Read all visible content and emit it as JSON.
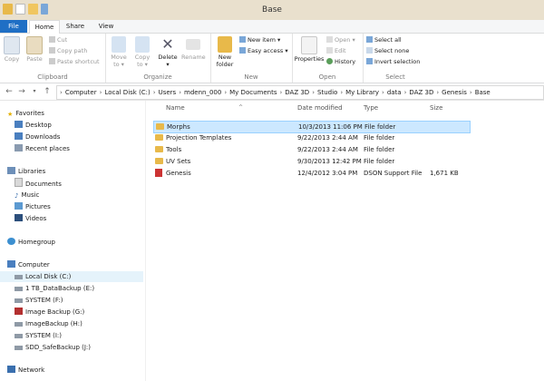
{
  "window": {
    "title": "Base"
  },
  "colors": {
    "file_tab": "#1f6fc5",
    "titlebar": "#e9e0cd",
    "folder": "#e8b94a",
    "selection": "#cce8ff"
  },
  "tabs": [
    "File",
    "Home",
    "Share",
    "View"
  ],
  "ribbon": {
    "clipboard": {
      "label": "Clipboard",
      "copy": "Copy",
      "paste": "Paste",
      "cut": "Cut",
      "copy_path": "Copy path",
      "paste_shortcut": "Paste shortcut"
    },
    "organize": {
      "label": "Organize",
      "move_to": "Move to",
      "copy_to": "Copy to",
      "delete": "Delete",
      "rename": "Rename"
    },
    "new": {
      "label": "New",
      "new_folder": "New folder",
      "new_item": "New item",
      "easy_access": "Easy access"
    },
    "open": {
      "label": "Open",
      "properties": "Properties",
      "open": "Open",
      "edit": "Edit",
      "history": "History"
    },
    "select": {
      "label": "Select",
      "select_all": "Select all",
      "select_none": "Select none",
      "invert": "Invert selection"
    }
  },
  "breadcrumb": [
    "Computer",
    "Local Disk (C:)",
    "Users",
    "mdenn_000",
    "My Documents",
    "DAZ 3D",
    "Studio",
    "My Library",
    "data",
    "DAZ 3D",
    "Genesis",
    "Base"
  ],
  "nav": {
    "favorites": "Favorites",
    "favorites_items": [
      "Desktop",
      "Downloads",
      "Recent places"
    ],
    "libraries": "Libraries",
    "libraries_items": [
      "Documents",
      "Music",
      "Pictures",
      "Videos"
    ],
    "homegroup": "Homegroup",
    "computer": "Computer",
    "computer_items": [
      "Local Disk (C:)",
      "1 TB_DataBackup (E:)",
      "SYSTEM (F:)",
      "Image Backup (G:)",
      "ImageBackup (H:)",
      "SYSTEM (I:)",
      "SDD_SafeBackup (J:)"
    ],
    "network": "Network"
  },
  "columns": {
    "name": "Name",
    "date": "Date modified",
    "type": "Type",
    "size": "Size"
  },
  "files": [
    {
      "name": "Morphs",
      "date": "10/3/2013 11:06 PM",
      "type": "File folder",
      "size": ""
    },
    {
      "name": "Projection Templates",
      "date": "9/22/2013 2:44 AM",
      "type": "File folder",
      "size": ""
    },
    {
      "name": "Tools",
      "date": "9/22/2013 2:44 AM",
      "type": "File folder",
      "size": ""
    },
    {
      "name": "UV Sets",
      "date": "9/30/2013 12:42 PM",
      "type": "File folder",
      "size": ""
    },
    {
      "name": "Genesis",
      "date": "12/4/2012 3:04 PM",
      "type": "DSON Support File",
      "size": "1,671 KB"
    }
  ]
}
